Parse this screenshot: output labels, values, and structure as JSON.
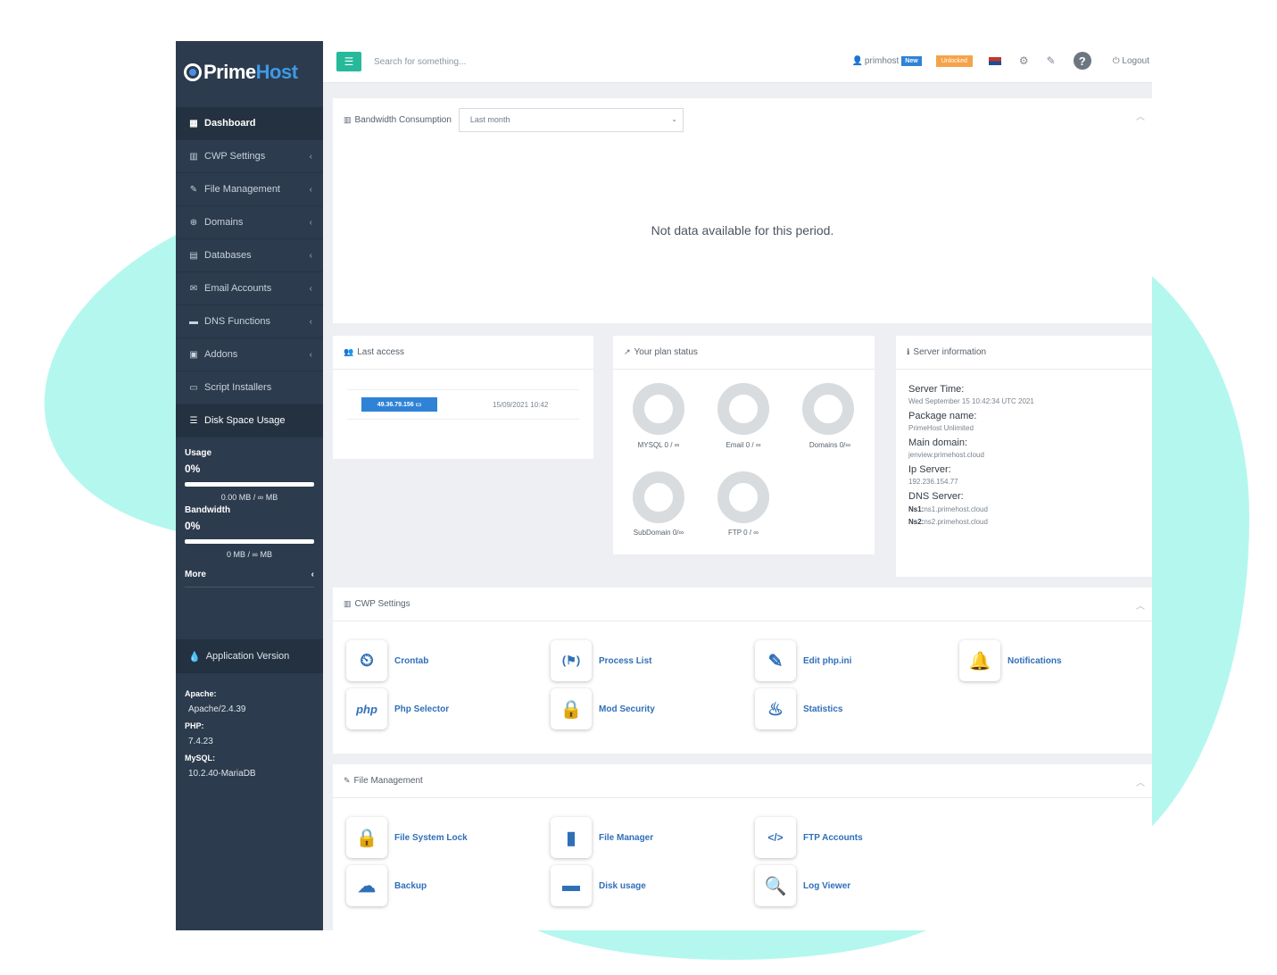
{
  "brand": {
    "name_part1": "Prime",
    "name_part2": "Host"
  },
  "sidebar": {
    "items": [
      {
        "label": "Dashboard",
        "icon": "grid-icon"
      },
      {
        "label": "CWP Settings",
        "icon": "chart-icon"
      },
      {
        "label": "File Management",
        "icon": "edit-icon"
      },
      {
        "label": "Domains",
        "icon": "globe-icon"
      },
      {
        "label": "Databases",
        "icon": "database-icon"
      },
      {
        "label": "Email Accounts",
        "icon": "envelope-icon"
      },
      {
        "label": "DNS Functions",
        "icon": "server-icon"
      },
      {
        "label": "Addons",
        "icon": "puzzle-icon"
      },
      {
        "label": "Script Installers",
        "icon": "monitor-icon"
      },
      {
        "label": "Disk Space Usage",
        "icon": "list-icon"
      }
    ],
    "usage": {
      "label": "Usage",
      "percent": "0%",
      "value": "0.00 MB / ∞ MB"
    },
    "bandwidth": {
      "label": "Bandwidth",
      "percent": "0%",
      "value": "0 MB / ∞ MB"
    },
    "more_label": "More",
    "app_version_label": "Application Version",
    "versions": [
      {
        "key": "Apache:",
        "value": "Apache/2.4.39"
      },
      {
        "key": "PHP:",
        "value": "7.4.23"
      },
      {
        "key": "MySQL:",
        "value": "10.2.40-MariaDB"
      }
    ]
  },
  "topbar": {
    "search_placeholder": "Search for something...",
    "user": "primhost",
    "new_badge": "New",
    "unlocked_badge": "Unlocked",
    "logout": "Logout"
  },
  "bandwidth": {
    "title": "Bandwidth Consumption",
    "period": "Last month",
    "empty_message": "Not data available for this period."
  },
  "last_access": {
    "title": "Last access",
    "ip": "49.36.79.156",
    "date": "15/09/2021 10:42"
  },
  "plan_status": {
    "title": "Your plan status",
    "items": [
      {
        "label": "MYSQL 0 / ∞"
      },
      {
        "label": "Email 0 / ∞"
      },
      {
        "label": "Domains 0/∞"
      },
      {
        "label": "SubDomain 0/∞"
      },
      {
        "label": "FTP 0 / ∞"
      }
    ]
  },
  "server_info": {
    "title": "Server information",
    "server_time_label": "Server Time:",
    "server_time": "Wed September 15 10:42:34 UTC 2021",
    "package_label": "Package name:",
    "package": "PrimeHost Unlimited",
    "domain_label": "Main domain:",
    "domain": "jenview.primehost.cloud",
    "ip_label": "Ip Server:",
    "ip": "192.236.154.77",
    "dns_label": "DNS Server:",
    "ns1_key": "Ns1:",
    "ns1": "ns1.primehost.cloud",
    "ns2_key": "Ns2:",
    "ns2": "ns2.primehost.cloud"
  },
  "cwp_settings": {
    "title": "CWP Settings",
    "tiles": [
      {
        "label": "Crontab",
        "icon": "crontab-icon",
        "glyph": "⏲"
      },
      {
        "label": "Process List",
        "icon": "process-list-icon",
        "glyph": "(⚑)"
      },
      {
        "label": "Edit php.ini",
        "icon": "edit-file-icon",
        "glyph": "✎"
      },
      {
        "label": "Notifications",
        "icon": "bell-icon",
        "glyph": "🔔"
      },
      {
        "label": "Php Selector",
        "icon": "php-icon",
        "glyph": "php"
      },
      {
        "label": "Mod Security",
        "icon": "lock-icon",
        "glyph": "🔒"
      },
      {
        "label": "Statistics",
        "icon": "statistics-icon",
        "glyph": "♨"
      }
    ]
  },
  "file_management": {
    "title": "File Management",
    "tiles": [
      {
        "label": "File System Lock",
        "icon": "lock-icon",
        "glyph": "🔒"
      },
      {
        "label": "File Manager",
        "icon": "file-archive-icon",
        "glyph": "▮"
      },
      {
        "label": "FTP Accounts",
        "icon": "file-code-icon",
        "glyph": "</>"
      },
      {
        "label": "Backup",
        "icon": "cloud-icon",
        "glyph": "☁"
      },
      {
        "label": "Disk usage",
        "icon": "hard-drive-icon",
        "glyph": "▬"
      },
      {
        "label": "Log Viewer",
        "icon": "magnifier-icon",
        "glyph": "🔍"
      }
    ]
  },
  "colors": {
    "sidebar_bg": "#2c3b4d",
    "accent_green": "#26b99a",
    "accent_blue": "#2f83d6",
    "badge_orange": "#f5a34b",
    "background_blob": "#b4f7ee"
  }
}
